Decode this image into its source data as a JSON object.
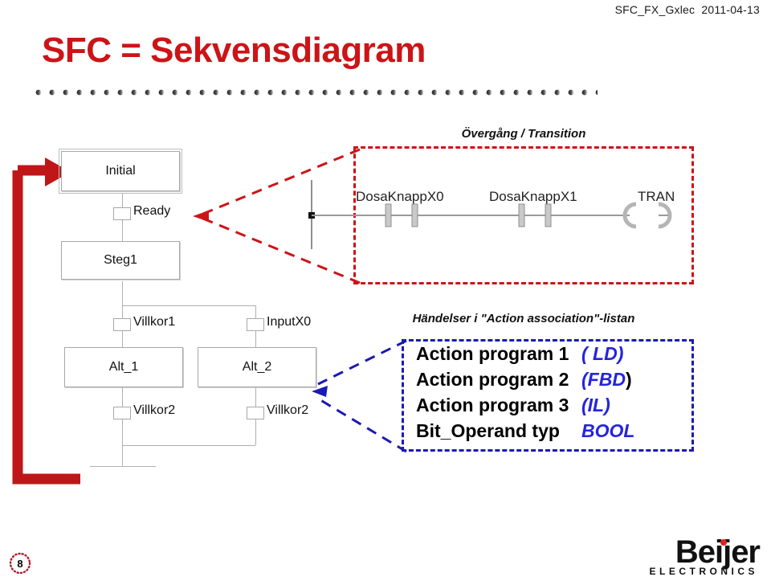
{
  "header": {
    "doc_code": "SFC_FX_Gxlec  2011-04-13"
  },
  "title": "SFC = Sekvensdiagram",
  "sfc": {
    "steps": [
      {
        "id": "initial",
        "label": "Initial",
        "type": "initial-step"
      },
      {
        "id": "steg1",
        "label": "Steg1",
        "type": "step"
      },
      {
        "id": "alt1",
        "label": "Alt_1",
        "type": "step"
      },
      {
        "id": "alt2",
        "label": "Alt_2",
        "type": "step"
      }
    ],
    "transitions": [
      {
        "id": "ready",
        "label": "Ready"
      },
      {
        "id": "villkor1",
        "label": "Villkor1"
      },
      {
        "id": "inputx0",
        "label": "InputX0"
      },
      {
        "id": "villkor2a",
        "label": "Villkor2"
      },
      {
        "id": "villkor2b",
        "label": "Villkor2"
      }
    ]
  },
  "callouts": {
    "transition": {
      "title": "Övergång / Transition",
      "accent_color": "#cc1417",
      "ladder": {
        "contacts": [
          "DosaKnappX0",
          "DosaKnappX1"
        ],
        "coil": "TRAN"
      }
    },
    "actions": {
      "title": "Händelser i \"Action association\"-listan",
      "accent_color": "#1a1ab4",
      "rows": [
        {
          "name": "Action program 1",
          "kind": "( LD)",
          "tail": ""
        },
        {
          "name": "Action program 2",
          "kind": "(FBD",
          "tail": ")"
        },
        {
          "name": "Action program 3",
          "kind": "(IL)",
          "tail": ""
        },
        {
          "name": "Bit_Operand typ",
          "kind": "BOOL",
          "tail": ""
        }
      ]
    }
  },
  "footer": {
    "page_number": "8",
    "brand_name": "Beijer",
    "brand_subtitle": "ELECTRONICS"
  },
  "colors": {
    "title_red": "#cc1417",
    "callout_red": "#cc1417",
    "callout_blue": "#1a1ab4",
    "action_blue": "#2424dd",
    "diagram_gray": "#b0b0b0"
  }
}
